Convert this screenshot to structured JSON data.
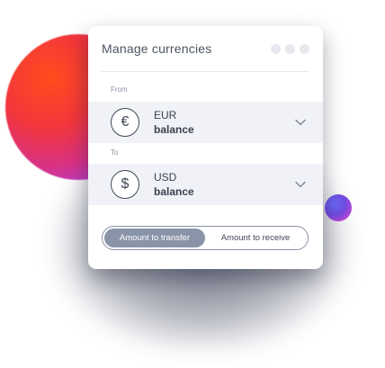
{
  "card": {
    "title": "Manage currencies",
    "window_dots": [
      "",
      "",
      ""
    ],
    "from": {
      "label": "From",
      "currency_symbol": "€",
      "currency_icon": "euro-icon",
      "code": "EUR",
      "balance_label": "balance"
    },
    "to": {
      "label": "To",
      "currency_symbol": "$",
      "currency_icon": "dollar-icon",
      "code": "USD",
      "balance_label": "balance"
    },
    "toggle": {
      "options": [
        "Amount to transfer",
        "Amount to receive"
      ],
      "selected": "Amount to transfer"
    }
  },
  "colors": {
    "orb_primary": "#f2363d",
    "orb_secondary": "#b040d0",
    "accent_blue": "#6a6cf6",
    "toggle_active": "#8a94a9"
  }
}
